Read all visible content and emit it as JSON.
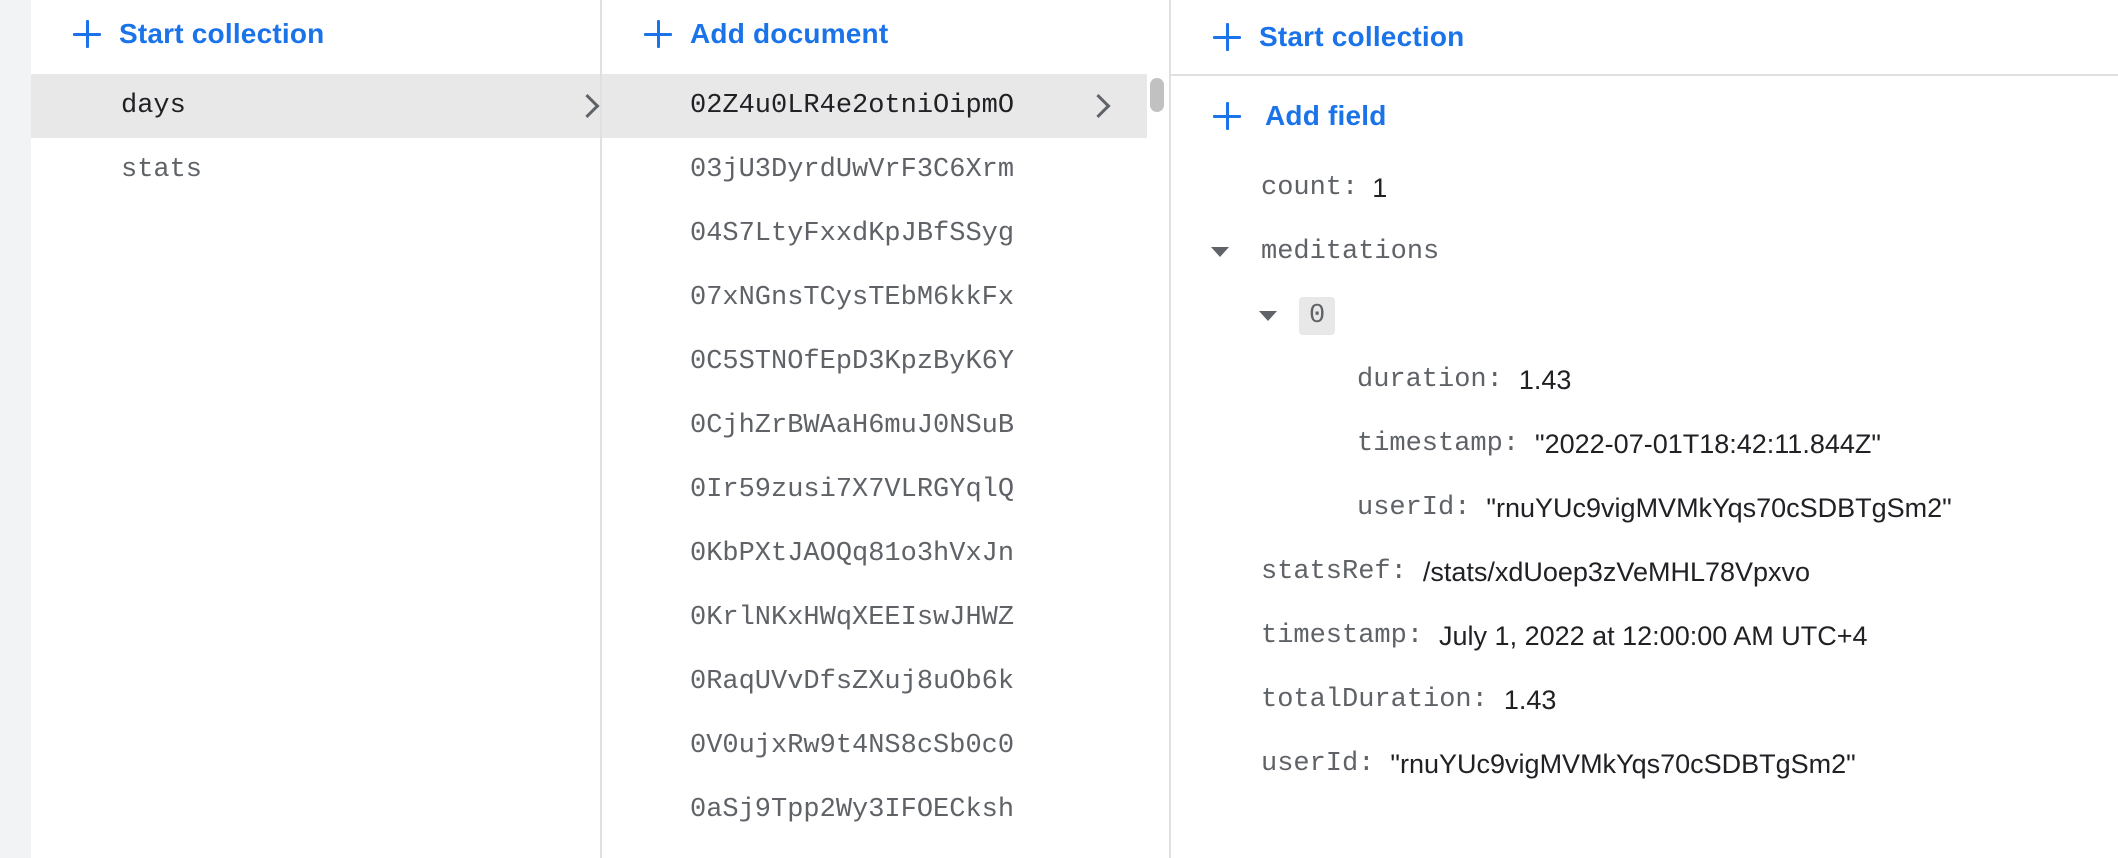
{
  "collections_panel": {
    "start_collection_label": "Start collection",
    "items": [
      {
        "label": "days",
        "selected": true
      },
      {
        "label": "stats",
        "selected": false
      }
    ]
  },
  "documents_panel": {
    "add_document_label": "Add document",
    "items": [
      {
        "label": "02Z4u0LR4e2otniOipmO",
        "selected": true
      },
      {
        "label": "03jU3DyrdUwVrF3C6Xrm",
        "selected": false
      },
      {
        "label": "04S7LtyFxxdKpJBfSSyg",
        "selected": false
      },
      {
        "label": "07xNGnsTCysTEbM6kkFx",
        "selected": false
      },
      {
        "label": "0C5STNOfEpD3KpzByK6Y",
        "selected": false
      },
      {
        "label": "0CjhZrBWAaH6muJ0NSuB",
        "selected": false
      },
      {
        "label": "0Ir59zusi7X7VLRGYqlQ",
        "selected": false
      },
      {
        "label": "0KbPXtJAOQq81o3hVxJn",
        "selected": false
      },
      {
        "label": "0KrlNKxHWqXEEIswJHWZ",
        "selected": false
      },
      {
        "label": "0RaqUVvDfsZXuj8uOb6k",
        "selected": false
      },
      {
        "label": "0V0ujxRw9t4NS8cSb0c0",
        "selected": false
      },
      {
        "label": "0aSj9Tpp2Wy3IFOECksh",
        "selected": false
      }
    ]
  },
  "document_panel": {
    "start_collection_label": "Start collection",
    "add_field_label": "Add field",
    "fields": {
      "count": {
        "key": "count:",
        "value": "1"
      },
      "meditations": {
        "key": "meditations"
      },
      "meditation_index": "0",
      "duration": {
        "key": "duration:",
        "value": "1.43"
      },
      "timestamp_inner": {
        "key": "timestamp:",
        "value": "\"2022-07-01T18:42:11.844Z\""
      },
      "userId_inner": {
        "key": "userId:",
        "value": "\"rnuYUc9vigMVMkYqs70cSDBTgSm2\""
      },
      "statsRef": {
        "key": "statsRef:",
        "value": "/stats/xdUoep3zVeMHL78Vpxvo"
      },
      "timestamp": {
        "key": "timestamp:",
        "value": "July 1, 2022 at 12:00:00 AM UTC+4"
      },
      "totalDuration": {
        "key": "totalDuration:",
        "value": "1.43"
      },
      "userId": {
        "key": "userId:",
        "value": "\"rnuYUc9vigMVMkYqs70cSDBTgSm2\""
      }
    }
  },
  "colors": {
    "accent": "#1a73e8",
    "selected_bg": "#e8e8e8",
    "key_text": "#5f6368",
    "value_text": "#202124"
  }
}
